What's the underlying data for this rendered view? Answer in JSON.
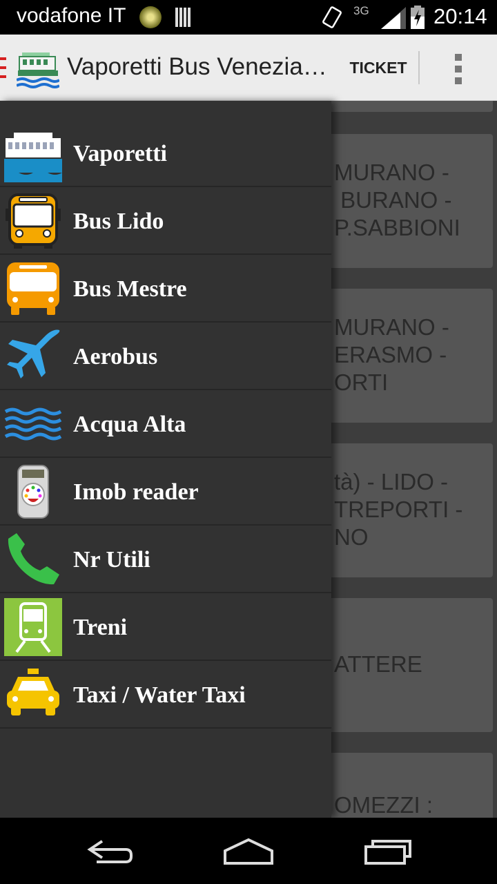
{
  "status_bar": {
    "carrier": "vodafone IT",
    "network": "3G",
    "time": "20:14"
  },
  "action_bar": {
    "title": "Vaporetti Bus Venezia…",
    "ticket_label": "TICKET",
    "accent_color": "#d62020"
  },
  "background_cards": [
    {
      "text": "MURANO -\n BURANO -\nP.SABBIONI"
    },
    {
      "text": "MURANO -\nERASMO -\nORTI"
    },
    {
      "text": "tà) - LIDO -\nTREPORTI -\nNO"
    },
    {
      "text": "ATTERE"
    },
    {
      "text": "OMEZZI :"
    }
  ],
  "drawer": {
    "items": [
      {
        "label": "Vaporetti",
        "icon": "ferry-icon"
      },
      {
        "label": "Bus Lido",
        "icon": "bus-front-icon"
      },
      {
        "label": "Bus Mestre",
        "icon": "bus-orange-icon"
      },
      {
        "label": "Aerobus",
        "icon": "airplane-icon"
      },
      {
        "label": "Acqua Alta",
        "icon": "waves-icon"
      },
      {
        "label": "Imob reader",
        "icon": "card-reader-icon"
      },
      {
        "label": "Nr Utili",
        "icon": "phone-icon"
      },
      {
        "label": "Treni",
        "icon": "train-icon"
      },
      {
        "label": "Taxi / Water Taxi",
        "icon": "taxi-icon"
      }
    ]
  }
}
